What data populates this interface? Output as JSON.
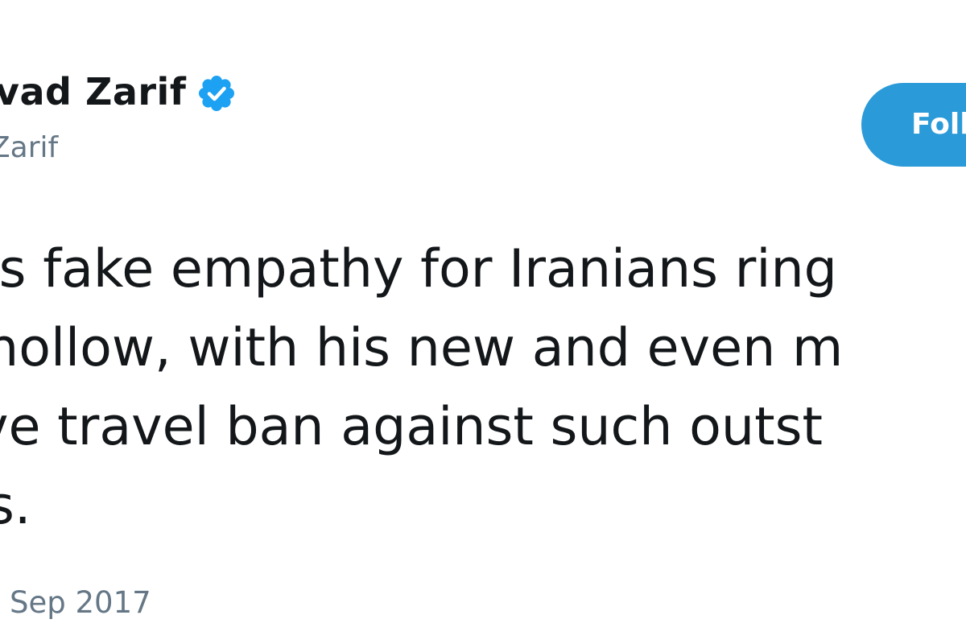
{
  "author": {
    "display_name": "vad Zarif",
    "handle": "Zarif",
    "verified_icon": "verified-badge-icon"
  },
  "follow_button": {
    "label": "Foll"
  },
  "tweet": {
    "lines": [
      "’s fake empathy for Iranians ring",
      "hollow, with his new and even m",
      "ve travel ban against such outst",
      "s."
    ],
    "timestamp": "Sep 2017"
  },
  "colors": {
    "text": "#14171a",
    "secondary_text": "#657786",
    "follow_button_bg": "#2b9ad8",
    "verified_badge": "#1da1f2"
  }
}
